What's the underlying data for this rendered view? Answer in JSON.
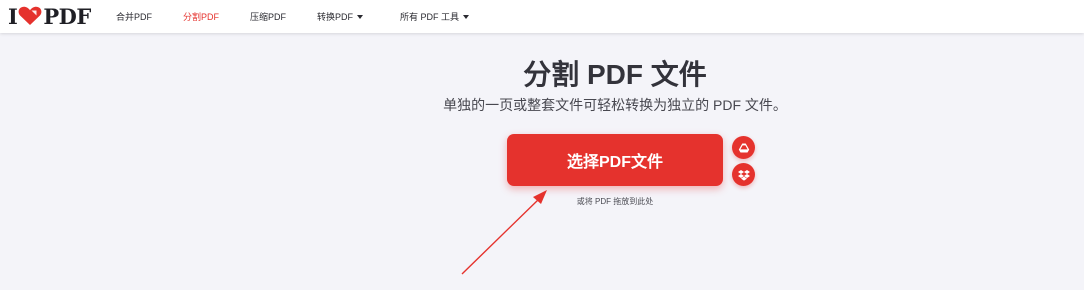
{
  "header": {
    "logo": {
      "prefix": "I",
      "suffix": "PDF"
    },
    "nav": [
      {
        "label": "合并PDF",
        "active": false,
        "dropdown": false
      },
      {
        "label": "分割PDF",
        "active": true,
        "dropdown": false
      },
      {
        "label": "压缩PDF",
        "active": false,
        "dropdown": false
      },
      {
        "label": "转换PDF",
        "active": false,
        "dropdown": true
      },
      {
        "label": "所有 PDF 工具",
        "active": false,
        "dropdown": true
      }
    ]
  },
  "main": {
    "title": "分割 PDF 文件",
    "subtitle": "单独的一页或整套文件可轻松转换为独立的 PDF 文件。",
    "select_button": "选择PDF文件",
    "drop_hint": "或将 PDF 拖放到此处",
    "cloud_buttons": [
      {
        "icon": "google-drive-icon"
      },
      {
        "icon": "dropbox-icon"
      }
    ]
  },
  "colors": {
    "brand": "#e5322d",
    "background": "#f4f4f9",
    "text": "#33333b"
  }
}
